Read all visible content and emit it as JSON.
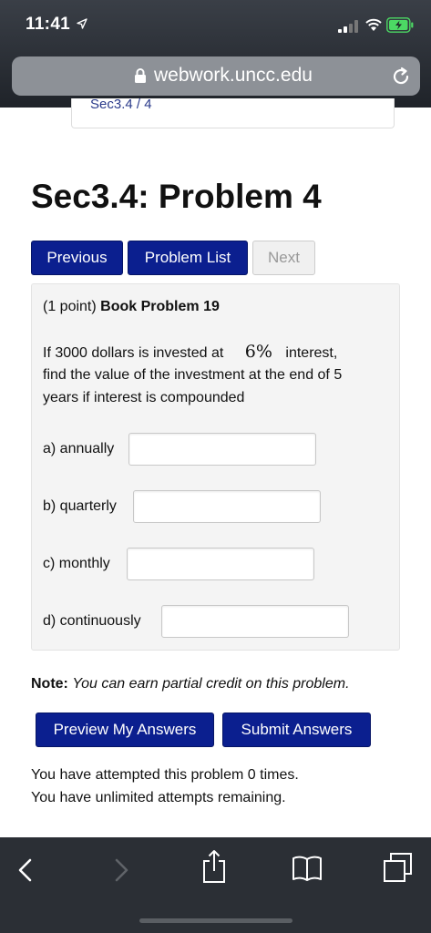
{
  "status_bar": {
    "time": "11:41"
  },
  "browser": {
    "url": "webwork.uncc.edu"
  },
  "page": {
    "previous_card_text": "Sec3.4 / 4",
    "title": "Sec3.4: Problem 4",
    "nav": {
      "previous": "Previous",
      "problem_list": "Problem List",
      "next": "Next"
    },
    "problem": {
      "points": "(1 point)",
      "heading": "Book Problem 19",
      "text_line1_a": "If 3000 dollars is invested at",
      "rate": "6%",
      "text_line1_b": "interest,",
      "text_line2": "find the value of the investment at the end of 5",
      "text_line3": "years if interest is compounded",
      "parts": [
        {
          "label": "a) annually",
          "value": ""
        },
        {
          "label": "b) quarterly",
          "value": ""
        },
        {
          "label": "c) monthly",
          "value": ""
        },
        {
          "label": "d) continuously",
          "value": ""
        }
      ]
    },
    "note_label": "Note:",
    "note_text": "You can earn partial credit on this problem.",
    "actions": {
      "preview": "Preview My Answers",
      "submit": "Submit Answers"
    },
    "attempts_line1": "You have attempted this problem 0 times.",
    "attempts_line2": "You have unlimited attempts remaining."
  },
  "colors": {
    "primary_button": "#0b1f8f",
    "chrome": "#2b2f35",
    "battery": "#4cd964"
  },
  "icons": [
    "location-arrow-icon",
    "signal-icon",
    "wifi-icon",
    "battery-icon",
    "lock-icon",
    "reload-icon",
    "back-icon",
    "forward-icon",
    "share-icon",
    "bookmarks-icon",
    "tabs-icon"
  ]
}
